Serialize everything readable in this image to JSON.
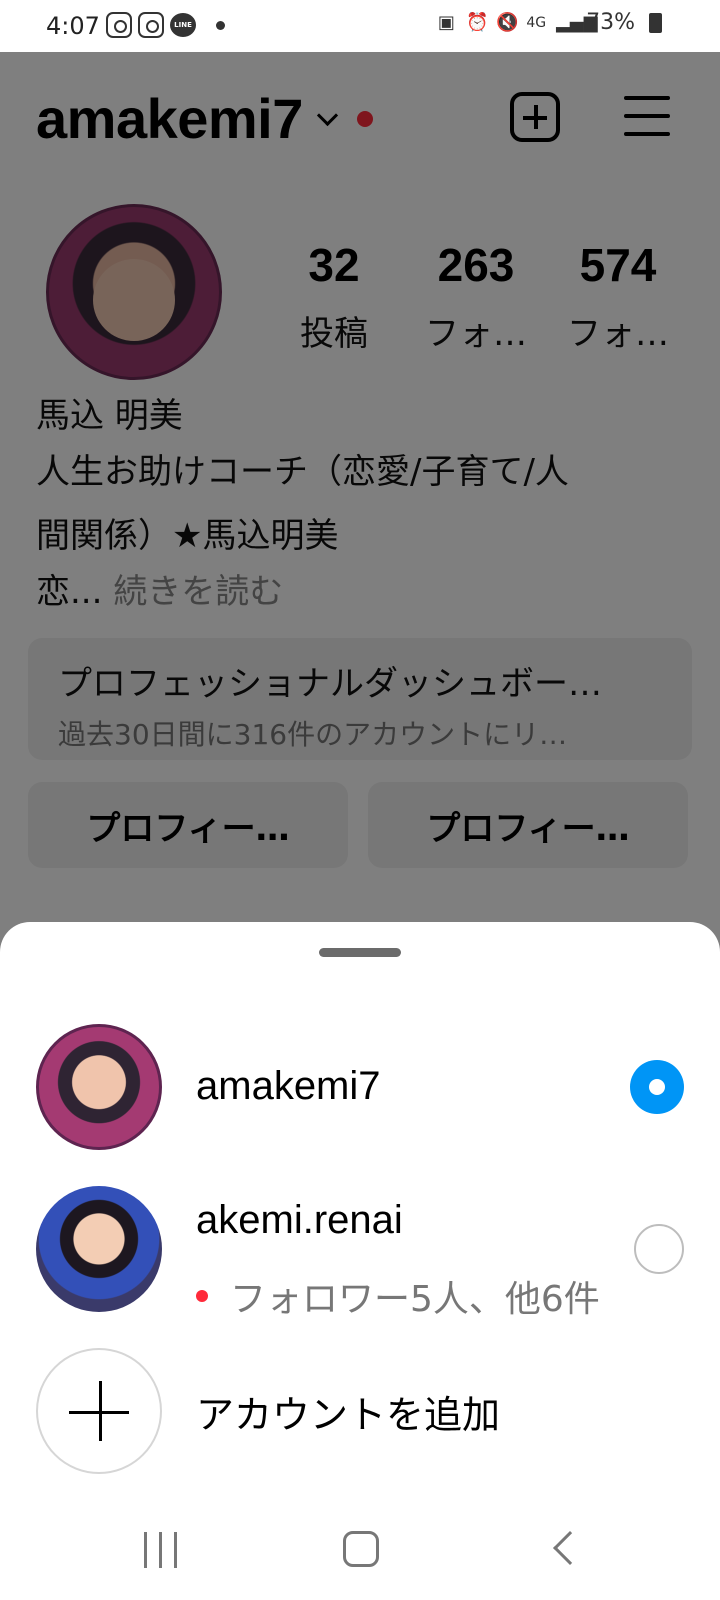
{
  "status_bar": {
    "time": "4:07",
    "network": "4G",
    "battery": "73%",
    "icons": [
      "instagram-icon",
      "instagram-icon",
      "line-icon",
      "dot-icon",
      "lock-icon",
      "alarm-icon",
      "mute-icon",
      "signal-icon",
      "battery-icon"
    ]
  },
  "profile": {
    "username": "amakemi7",
    "stats": [
      {
        "value": "32",
        "label": "投稿"
      },
      {
        "value": "263",
        "label": "フォ…"
      },
      {
        "value": "574",
        "label": "フォ…"
      }
    ],
    "bio": {
      "name": "馬込 明美",
      "line1": "人生お助けコーチ（恋愛/子育て/人",
      "line2": "間関係）★馬込明美",
      "line3": "恋...",
      "more": "続きを読む"
    },
    "dashboard": {
      "title": "プロフェッショナルダッシュボー…",
      "subtitle": "過去30日間に316件のアカウントにリ…"
    },
    "buttons": [
      "プロフィー…",
      "プロフィー…"
    ]
  },
  "account_sheet": {
    "accounts": [
      {
        "name": "amakemi7",
        "selected": true
      },
      {
        "name": "akemi.renai",
        "notice": "フォロワー5人、他6件",
        "selected": false
      }
    ],
    "add_account": "アカウントを追加"
  },
  "colors": {
    "accent": "#0095f6",
    "notification": "#ff2a3a"
  }
}
